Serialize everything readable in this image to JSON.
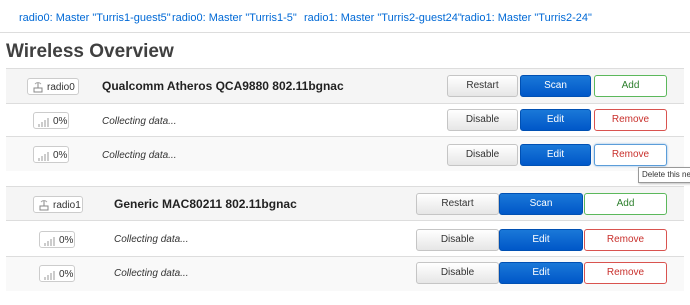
{
  "tabs": [
    "radio0: Master \"Turris1-guest5\"",
    "radio0: Master \"Turris1-5\"",
    "radio1: Master \"Turris2-guest24\"",
    "radio1: Master \"Turris2-24\""
  ],
  "page_title": "Wireless Overview",
  "devices": [
    {
      "chip_label": "radio0",
      "name": "Qualcomm Atheros QCA9880 802.11bgnac",
      "restart_label": "Restart",
      "scan_label": "Scan",
      "add_label": "Add",
      "networks": [
        {
          "signal": "0%",
          "status": "Collecting data...",
          "disable_label": "Disable",
          "edit_label": "Edit",
          "remove_label": "Remove"
        },
        {
          "signal": "0%",
          "status": "Collecting data...",
          "disable_label": "Disable",
          "edit_label": "Edit",
          "remove_label": "Remove"
        }
      ]
    },
    {
      "chip_label": "radio1",
      "name": "Generic MAC80211 802.11bgnac",
      "restart_label": "Restart",
      "scan_label": "Scan",
      "add_label": "Add",
      "networks": [
        {
          "signal": "0%",
          "status": "Collecting data...",
          "disable_label": "Disable",
          "edit_label": "Edit",
          "remove_label": "Remove"
        },
        {
          "signal": "0%",
          "status": "Collecting data...",
          "disable_label": "Disable",
          "edit_label": "Edit",
          "remove_label": "Remove"
        }
      ]
    }
  ],
  "tooltip": "Delete this ne",
  "icons": {
    "device": "wifi-radio-icon",
    "signal": "signal-bars-icon"
  },
  "colors": {
    "primary": "#0062cc",
    "add": "#5cb85c",
    "remove": "#d9534f",
    "link": "#0069d6"
  }
}
